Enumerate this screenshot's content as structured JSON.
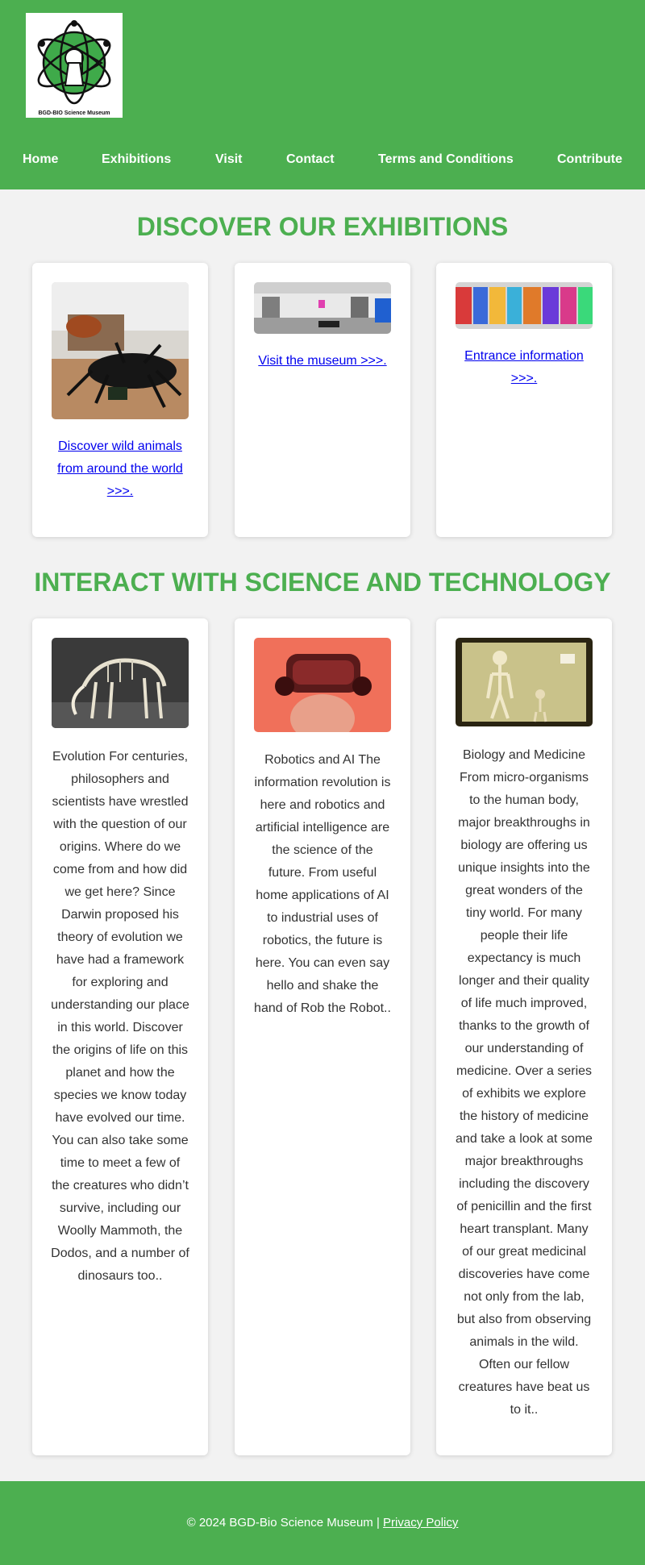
{
  "header": {
    "logo_caption": "BGD-BIO Science Museum",
    "nav": [
      "Home",
      "Exhibitions",
      "Visit",
      "Contact",
      "Terms and Conditions",
      "Contribute"
    ]
  },
  "exhibitions": {
    "title": "DISCOVER OUR EXHIBITIONS",
    "cards": [
      {
        "link": "Discover wild animals from around the world >>>."
      },
      {
        "link": "Visit the museum >>>."
      },
      {
        "link": "Entrance information >>>."
      }
    ]
  },
  "interact": {
    "title": "INTERACT WITH SCIENCE AND TECHNOLOGY",
    "cards": [
      {
        "text": "Evolution For centuries, philosophers and scientists have wrestled with the question of our origins. Where do we come from and how did we get here? Since Darwin proposed his theory of evolution we have had a framework for exploring and understanding our place in this world. Discover the origins of life on this planet and how the species we know today have evolved our time. You can also take some time to meet a few of the creatures who didn’t survive, including our Woolly Mammoth, the Dodos, and a number of dinosaurs too.."
      },
      {
        "text": "Robotics and AI The information revolution is here and robotics and artificial intelligence are the science of the future. From useful home applications of AI to industrial uses of robotics, the future is here. You can even say hello and shake the hand of Rob the Robot.."
      },
      {
        "text": "Biology and Medicine From micro-organisms to the human body, major breakthroughs in biology are offering us unique insights into the great wonders of the tiny world. For many people their life expectancy is much longer and their quality of life much improved, thanks to the growth of our understanding of medicine. Over a series of exhibits we explore the history of medicine and take a look at some major breakthroughs including the discovery of penicillin and the first heart transplant. Many of our great medicinal discoveries have come not only from the lab, but also from observing animals in the wild. Often our fellow creatures have beat us to it.."
      }
    ]
  },
  "footer": {
    "copyright": "© 2024 BGD-Bio Science Museum |",
    "privacy_link": "Privacy Policy"
  },
  "colors": {
    "brand_green": "#4caf50",
    "link_blue": "#0000ee",
    "background": "#f2f2f2"
  }
}
